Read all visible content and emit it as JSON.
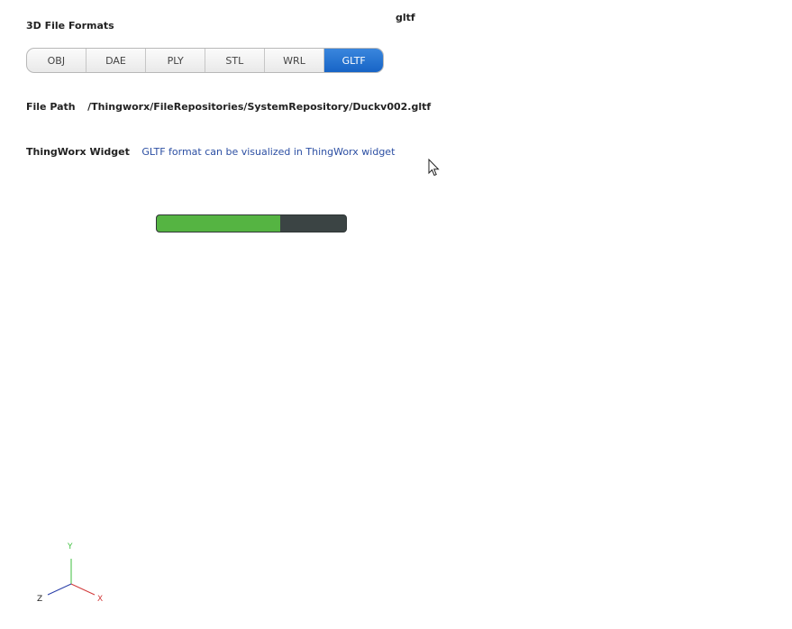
{
  "section": {
    "title": "3D File Formats",
    "selected_readout": "gltf"
  },
  "formats": [
    {
      "label": "OBJ",
      "active": false
    },
    {
      "label": "DAE",
      "active": false
    },
    {
      "label": "PLY",
      "active": false
    },
    {
      "label": "STL",
      "active": false
    },
    {
      "label": "WRL",
      "active": false
    },
    {
      "label": "GLTF",
      "active": true
    }
  ],
  "file_path": {
    "label": "File Path",
    "value": "/Thingworx/FileRepositories/SystemRepository/Duckv002.gltf"
  },
  "widget": {
    "label": "ThingWorx Widget",
    "value": "GLTF format can be visualized in ThingWorx widget"
  },
  "progress": {
    "fraction": 0.65,
    "fill_color": "#55b442",
    "track_color": "#3b4444"
  },
  "axes": {
    "x_label": "X",
    "y_label": "Y",
    "z_label": "Z",
    "x_color": "#d23a3a",
    "y_color": "#3fbf3f",
    "z_color": "#2a3fa8"
  },
  "colors": {
    "accent": "#1764c6",
    "link": "#2c4fa3"
  }
}
